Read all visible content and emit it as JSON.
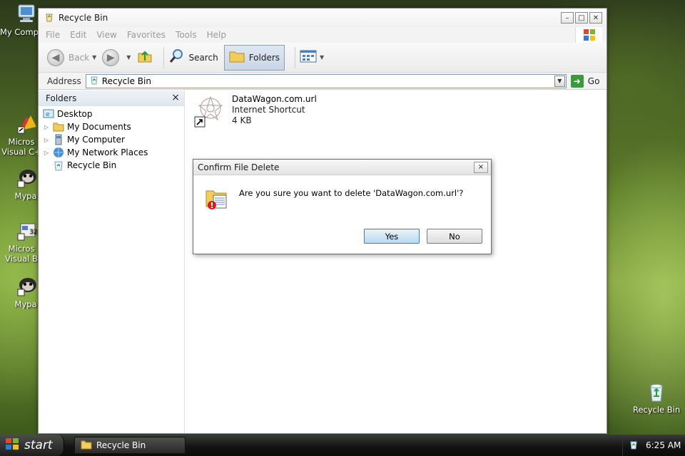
{
  "desktop": {
    "icons": [
      {
        "label": "My Comp",
        "icon": "my-computer-icon"
      },
      {
        "label": "Micros Visual C+",
        "icon": "visual-cpp-icon"
      },
      {
        "label": "Mypa",
        "icon": "mypal-icon"
      },
      {
        "label": "Micros Visual B",
        "icon": "visual-basic-icon"
      },
      {
        "label": "Mypa",
        "icon": "mypal-icon"
      },
      {
        "label": "Recycle Bin",
        "icon": "recycle-bin-icon"
      }
    ]
  },
  "window": {
    "title": "Recycle Bin",
    "controls": {
      "minimize": "–",
      "maximize": "□",
      "close": "✕"
    },
    "menu": [
      "File",
      "Edit",
      "View",
      "Favorites",
      "Tools",
      "Help"
    ],
    "toolbar": {
      "back_label": "Back",
      "search_label": "Search",
      "folders_label": "Folders"
    },
    "address": {
      "label": "Address",
      "value": "Recycle Bin",
      "go_label": "Go"
    },
    "folders_pane": {
      "title": "Folders",
      "close": "×",
      "tree": [
        {
          "label": "Desktop",
          "icon": "desktop-icon"
        },
        {
          "label": "My Documents",
          "icon": "folder-icon"
        },
        {
          "label": "My Computer",
          "icon": "computer-icon"
        },
        {
          "label": "My Network Places",
          "icon": "network-icon"
        },
        {
          "label": "Recycle Bin",
          "icon": "recycle-bin-icon"
        }
      ]
    },
    "content": {
      "file": {
        "name": "DataWagon.com.url",
        "type": "Internet Shortcut",
        "size": "4 KB"
      }
    }
  },
  "dialog": {
    "title": "Confirm File Delete",
    "close": "×",
    "message": "Are you sure you want to delete 'DataWagon.com.url'?",
    "yes_label": "Yes",
    "no_label": "No"
  },
  "taskbar": {
    "start_label": "start",
    "task_label": "Recycle Bin",
    "time": "6:25 AM"
  },
  "colors": {
    "accent": "#3c7fb1",
    "taskbar": "#141414"
  }
}
